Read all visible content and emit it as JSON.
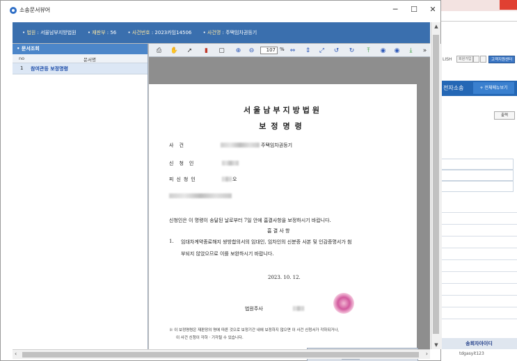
{
  "window": {
    "title": "소송문서뷰어",
    "minimize": "─",
    "maximize": "☐",
    "close": "✕"
  },
  "infobar": [
    {
      "key": "법원",
      "value": "서울남부지방법원"
    },
    {
      "key": "재판부",
      "value": "56"
    },
    {
      "key": "사건번호",
      "value": "2023카임14506"
    },
    {
      "key": "사건명",
      "value": "주택임차권등기"
    }
  ],
  "doclist": {
    "header": "문서조회",
    "col_no": "no",
    "col_name": "문서명",
    "rows": [
      {
        "no": "1",
        "name": "참여관등 보정명령"
      }
    ]
  },
  "toolbar": {
    "zoom": "107",
    "zoom_unit": "%"
  },
  "document": {
    "court": "서울남부지방법원",
    "title": "보정명령",
    "label_case": "사건",
    "case_value": "주택임차권등기",
    "label_applicant": "신청인",
    "label_respondent": "피신청인",
    "respondent_value": "오",
    "body_1": "신청인은 이 명령이 송달된 날로부터 7일 안에 흠결사항을 보정하시기 바랍니다.",
    "defects_heading": "흠 결 사 항",
    "item_no": "1.",
    "item_1a": "임대차계약종료해지 쌍방합의서의 임대인, 임차인의 신분증 사본 및 인감증명서가 첨",
    "item_1b": "부되지 않았으므로 이를 보완하시기 바랍니다.",
    "date": "2023. 10. 12.",
    "signer_label": "법원주사",
    "note_1": "※ 이 보정명령은 재판장의 명에 따른 것으로 보정기간 내에 보정하지 않으면 이 사건 신청서가 각하되거나,",
    "note_2": "이 사건 신청이 각하 · 기각될 수 있습니다."
  },
  "pager": {
    "current": "1",
    "total": "/ 2"
  },
  "background": {
    "lang": "LISH",
    "btn1": "회원가입",
    "help": "고객지원센터",
    "nav_label": "전자소송",
    "nav_all": "+ 전체메뉴보기",
    "print": "출력",
    "table_header": "송회자아이디",
    "table_cell": "tdgasyit123"
  }
}
